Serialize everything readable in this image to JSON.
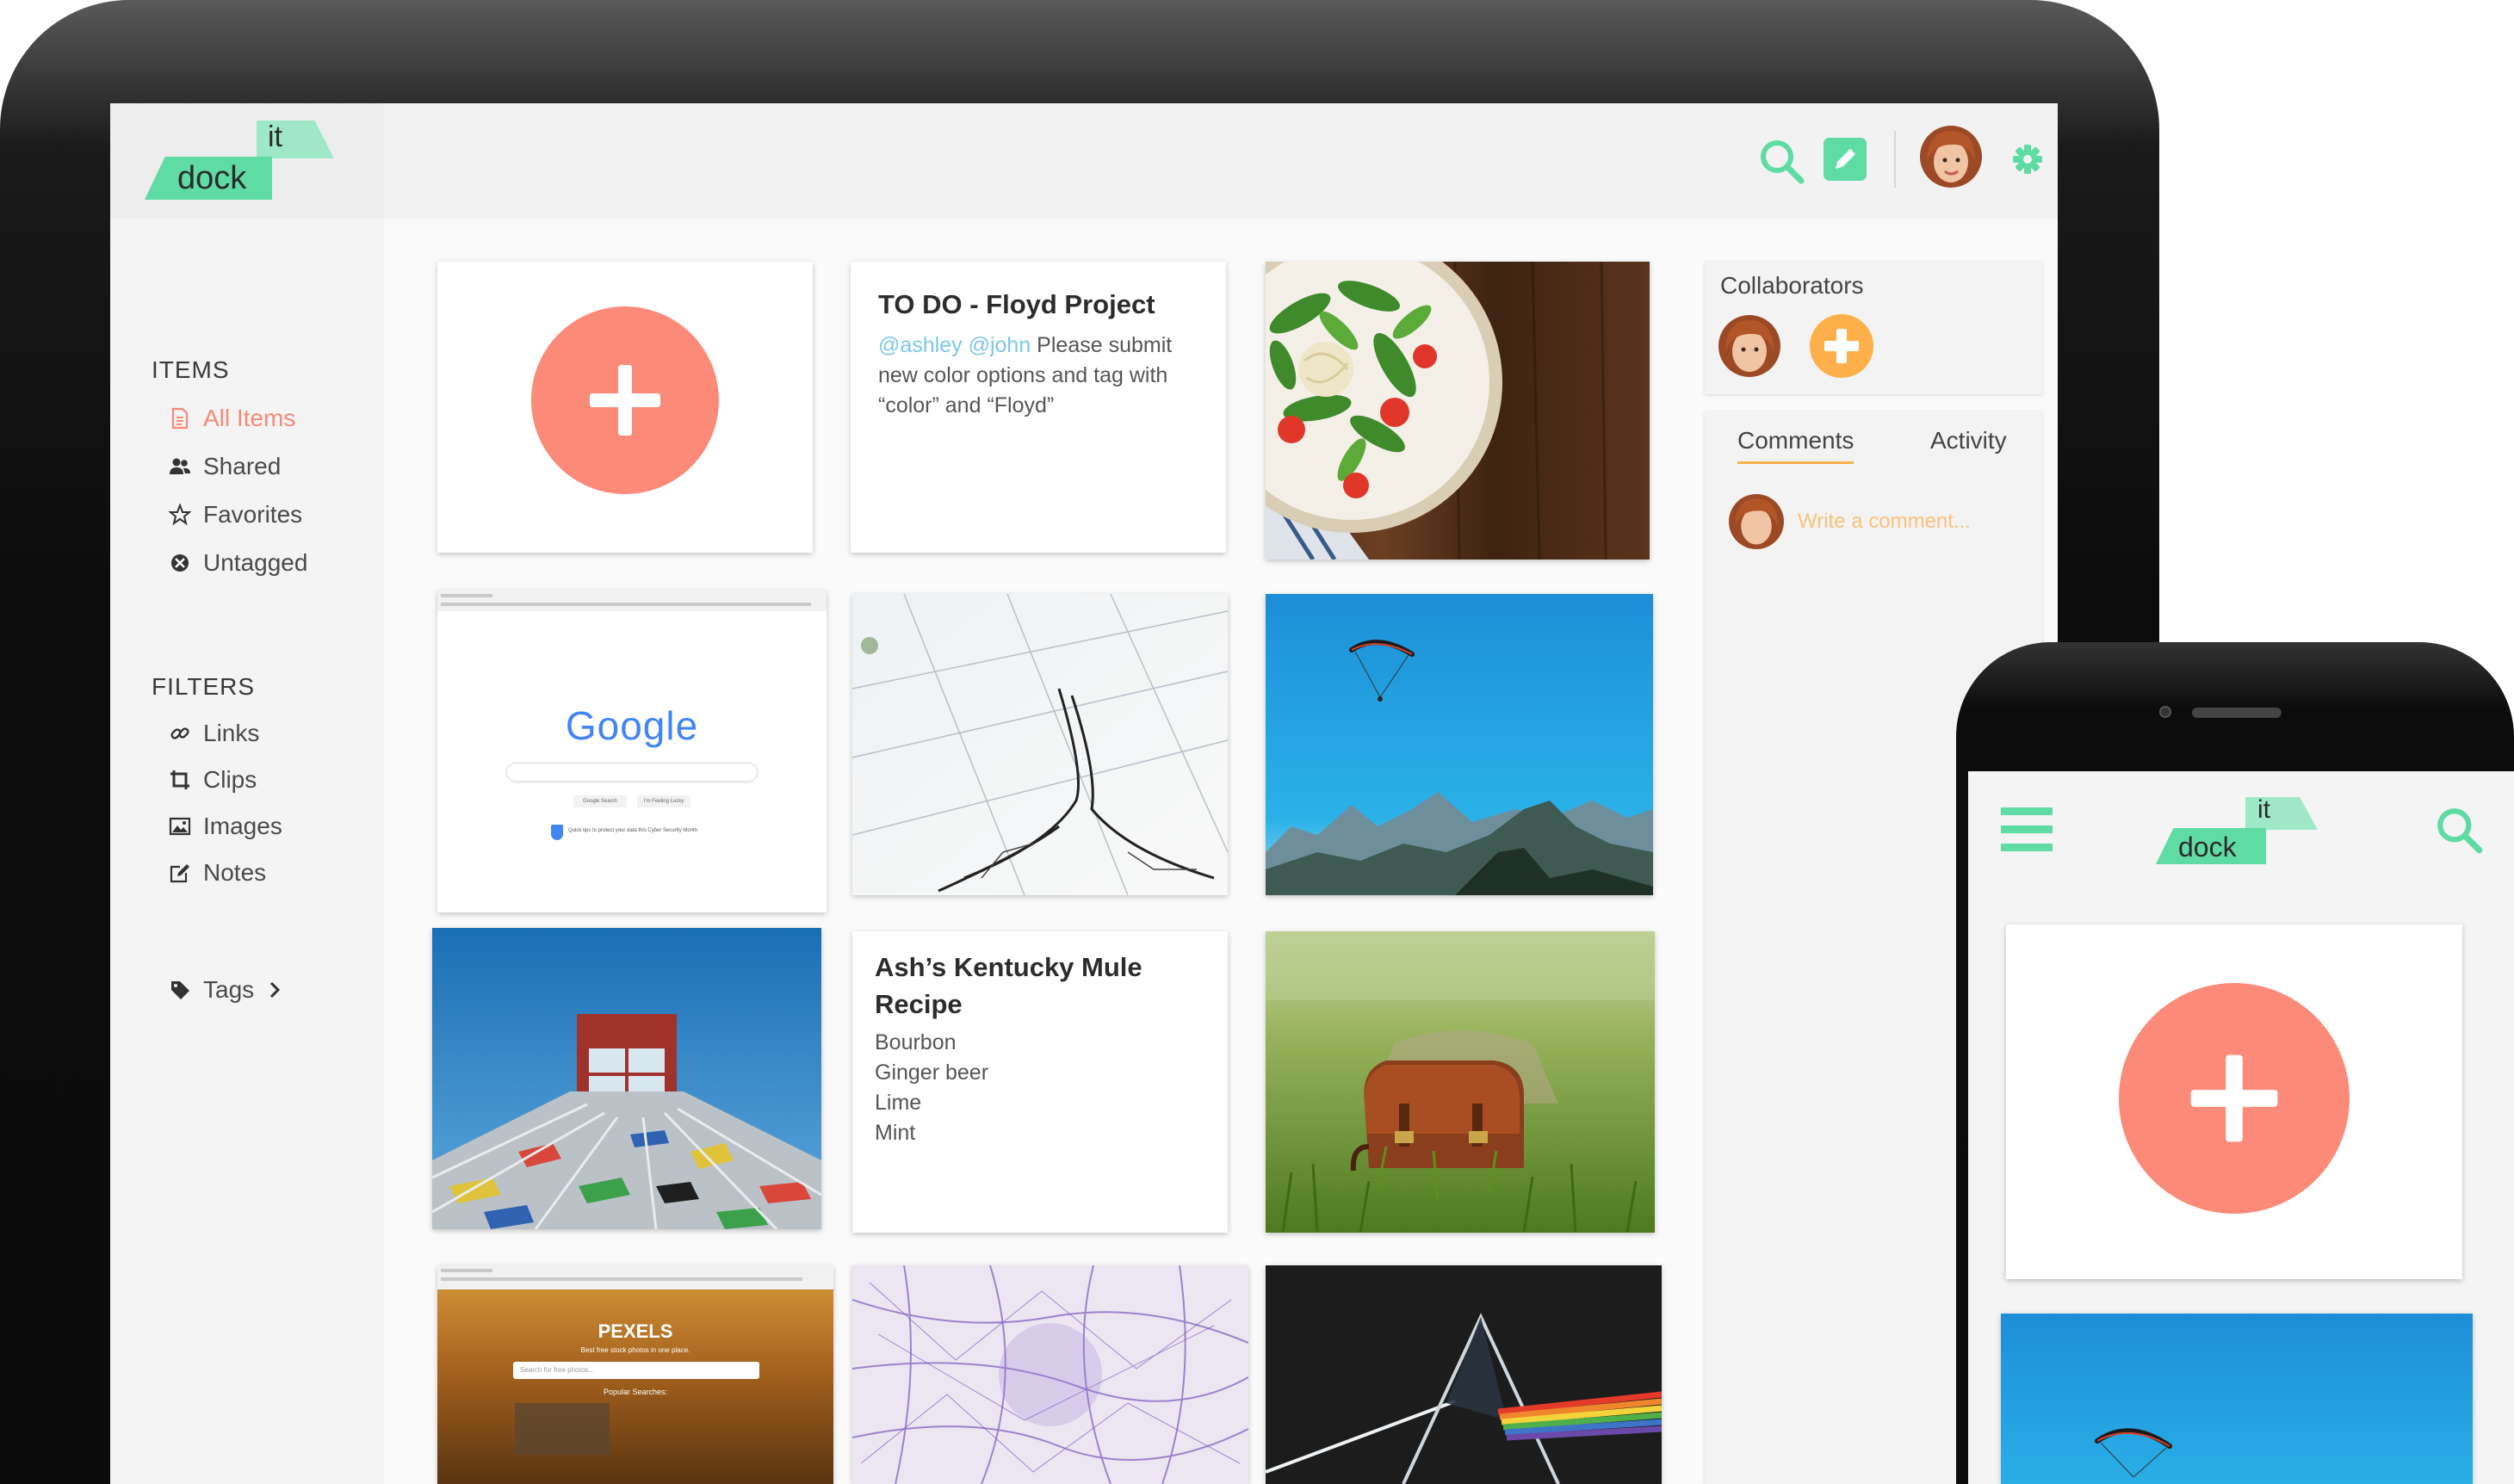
{
  "app": {
    "logo_top": "it",
    "logo_main": "dock"
  },
  "header": {
    "icons": [
      "search-icon",
      "edit-icon",
      "avatar",
      "gear-icon"
    ]
  },
  "sidebar": {
    "items_title": "ITEMS",
    "items": [
      {
        "label": "All Items",
        "icon": "document-icon",
        "active": true
      },
      {
        "label": "Shared",
        "icon": "users-icon"
      },
      {
        "label": "Favorites",
        "icon": "star-icon"
      },
      {
        "label": "Untagged",
        "icon": "untagged-icon"
      }
    ],
    "filters_title": "FILTERS",
    "filters": [
      {
        "label": "Links",
        "icon": "link-icon"
      },
      {
        "label": "Clips",
        "icon": "crop-icon"
      },
      {
        "label": "Images",
        "icon": "image-icon"
      },
      {
        "label": "Notes",
        "icon": "note-icon"
      }
    ],
    "tags_label": "Tags"
  },
  "cards": {
    "todo": {
      "title": "TO DO - Floyd Project",
      "mentions": "@ashley @john",
      "body": " Please submit new color options and tag with “color” and “Floyd”"
    },
    "google": {
      "logo": "Google",
      "btn1": "Google Search",
      "btn2": "I'm Feeling Lucky",
      "note": "Quick tips to protect your data this Cyber Security Month"
    },
    "recipe": {
      "title": "Ash’s Kentucky Mule Recipe",
      "lines": [
        "Bourbon",
        "Ginger beer",
        "Lime",
        "Mint"
      ]
    },
    "pexels": {
      "brand": "PEXELS",
      "tagline": "Best free stock photos in one place.",
      "search_placeholder": "Search for free photos...",
      "popular": "Popular Searches:"
    }
  },
  "panel": {
    "collaborators_title": "Collaborators",
    "tabs": [
      {
        "label": "Comments",
        "active": true
      },
      {
        "label": "Activity"
      }
    ],
    "comment_placeholder": "Write a comment..."
  },
  "colors": {
    "accent": "#5fdba4",
    "coral": "#fb8a78",
    "orange": "#fdb04a"
  }
}
